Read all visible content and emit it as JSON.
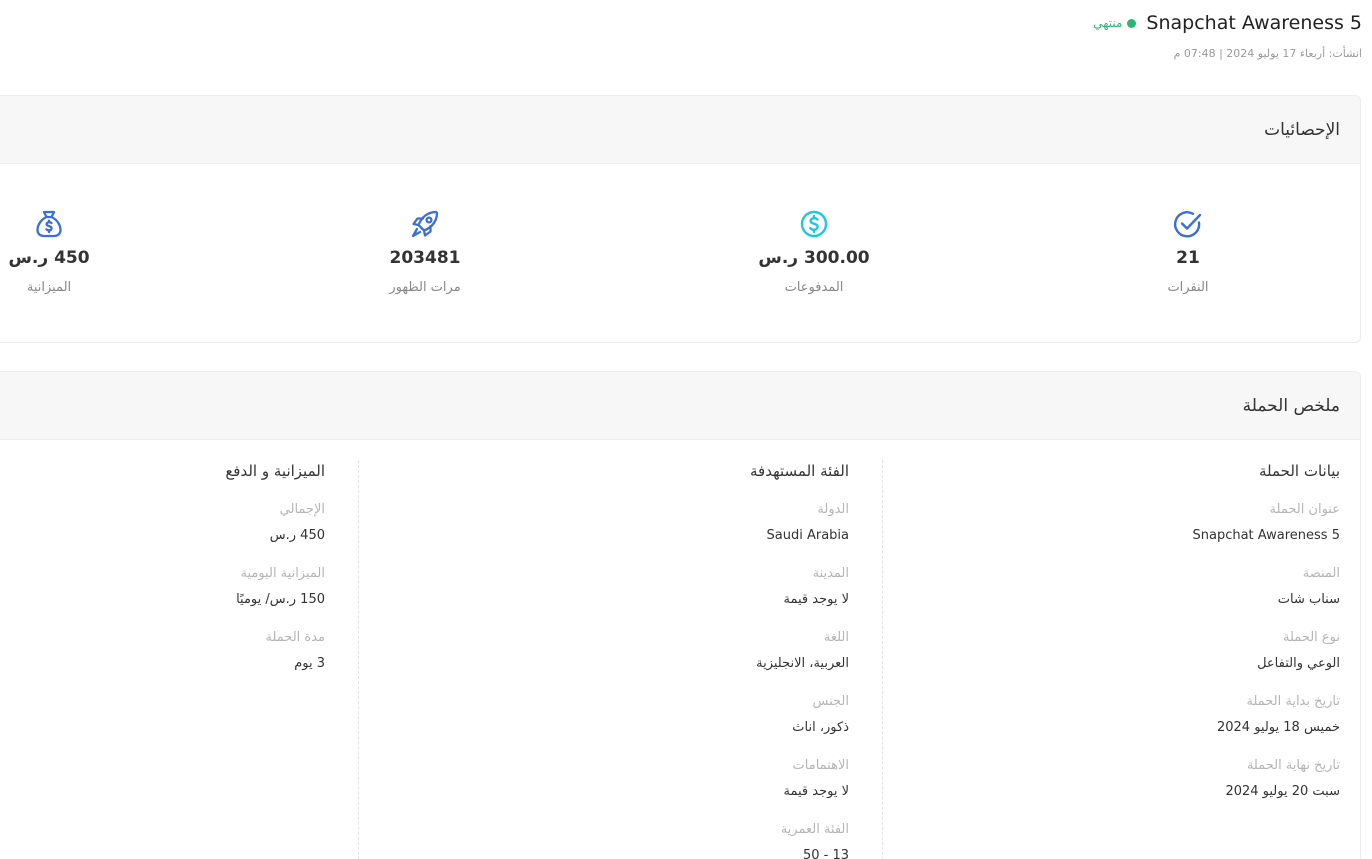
{
  "header": {
    "campaign_name": "Snapchat Awareness 5",
    "status": "منتهي",
    "created": "انشأت: أربعاء 17 يوليو 2024 | 07:48 م"
  },
  "stats": {
    "title": "الإحصائيات",
    "items": [
      {
        "label": "النقرات",
        "value": "21",
        "icon": "check-circle-icon"
      },
      {
        "label": "المدفوعات",
        "value": "300.00 ر.س",
        "icon": "dollar-circle-icon"
      },
      {
        "label": "مرات الظهور",
        "value": "203481",
        "icon": "rocket-icon"
      },
      {
        "label": "الميزانية",
        "value": "450 ر.س",
        "icon": "money-bag-icon"
      }
    ]
  },
  "summary": {
    "title": "ملخص الحملة",
    "campaign_info": {
      "title": "بيانات الحملة",
      "fields": [
        {
          "label": "عنوان الحملة",
          "value": "Snapchat Awareness 5"
        },
        {
          "label": "المنصة",
          "value": "سناب شات"
        },
        {
          "label": "نوع الحملة",
          "value": "الوعي والتفاعل"
        },
        {
          "label": "تاريخ بداية الحملة",
          "value": "خميس 18 يوليو 2024"
        },
        {
          "label": "تاريخ نهاية الحملة",
          "value": "سبت 20 يوليو 2024"
        }
      ]
    },
    "target": {
      "title": "الفئة المستهدفة",
      "fields": [
        {
          "label": "الدولة",
          "value": "Saudi Arabia"
        },
        {
          "label": "المدينة",
          "value": "لا يوجد قيمة"
        },
        {
          "label": "اللغة",
          "value": "العربية، الانجليزية"
        },
        {
          "label": "الجنس",
          "value": "ذكور، اناث"
        },
        {
          "label": "الاهتمامات",
          "value": "لا يوجد قيمة"
        },
        {
          "label": "الفئة العمرية",
          "value": "13 - 50"
        }
      ]
    },
    "budget": {
      "title": "الميزانية و الدفع",
      "fields": [
        {
          "label": "الإجمالي",
          "value": "450 ر.س"
        },
        {
          "label": "الميزانية اليومية",
          "value": "150 ر.س/ يوميًا"
        },
        {
          "label": "مدة الحملة",
          "value": "3 يوم"
        }
      ]
    }
  },
  "colors": {
    "status_green": "#2bb673",
    "icon_blue": "#3b6fd6",
    "icon_cyan": "#1ec8e0"
  }
}
